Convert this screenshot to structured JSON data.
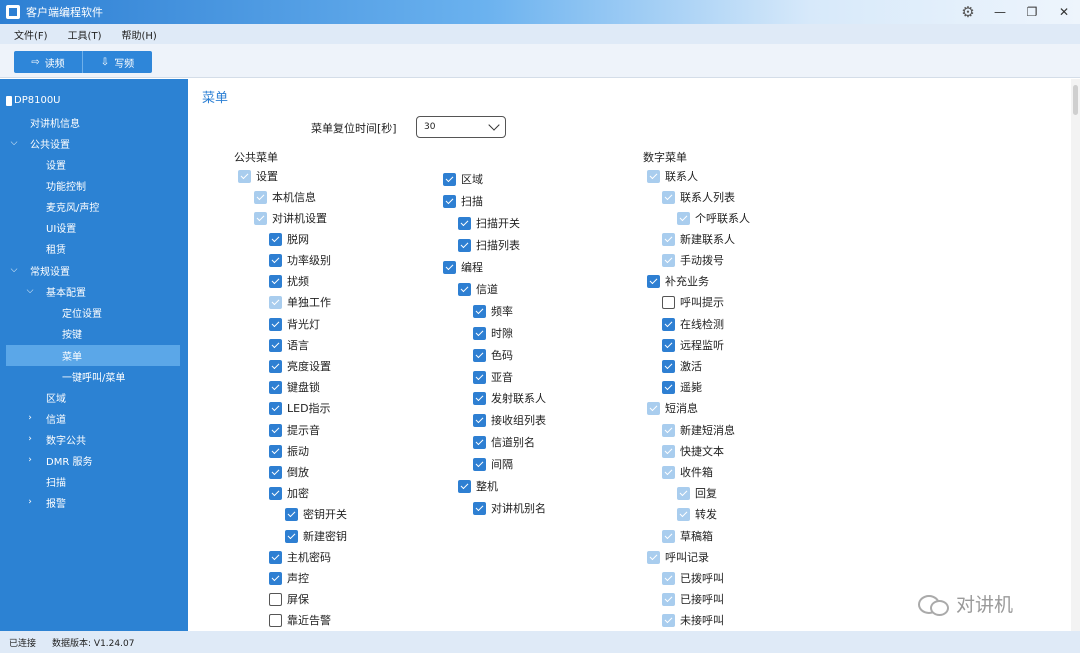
{
  "window": {
    "title": "客户端编程软件"
  },
  "menu": {
    "file": "文件(F)",
    "tools": "工具(T)",
    "help": "帮助(H)"
  },
  "toolbar": {
    "read": "读频",
    "write": "写频"
  },
  "sidebar": {
    "device": "DP8100U",
    "items": {
      "intercom_info": "对讲机信息",
      "public_settings": "公共设置",
      "settings": "设置",
      "function_control": "功能控制",
      "mic_audio": "麦克风/声控",
      "ui_settings": "UI设置",
      "rental": "租赁",
      "general_settings": "常规设置",
      "basic_config": "基本配置",
      "location": "定位设置",
      "keys": "按键",
      "menu": "菜单",
      "one_key_call": "一键呼叫/菜单",
      "zone": "区域",
      "channel": "信道",
      "digital_public": "数字公共",
      "dmr_service": "DMR 服务",
      "scan": "扫描",
      "alarm": "报警"
    }
  },
  "main": {
    "title": "菜单",
    "reset_label": "菜单复位时间[秒]",
    "reset_value": "30",
    "public_menu_label": "公共菜单",
    "digital_menu_label": "数字菜单",
    "col1": {
      "settings": "设置",
      "local_info": "本机信息",
      "radio_settings": "对讲机设置",
      "offline": "脱网",
      "power_level": "功率级别",
      "scramble": "扰频",
      "single_work": "单独工作",
      "backlight": "背光灯",
      "language": "语言",
      "brightness": "亮度设置",
      "keylock": "键盘锁",
      "led": "LED指示",
      "tone": "提示音",
      "vibrate": "振动",
      "fall": "倒放",
      "encrypt": "加密",
      "key_switch": "密钥开关",
      "new_key": "新建密钥",
      "host_password": "主机密码",
      "voice_control": "声控",
      "screensaver": "屏保",
      "proximity_alarm": "靠近告警"
    },
    "col2": {
      "zone": "区域",
      "scan": "扫描",
      "scan_switch": "扫描开关",
      "scan_list": "扫描列表",
      "program": "编程",
      "channel": "信道",
      "frequency": "频率",
      "timeslot": "时隙",
      "color_code": "色码",
      "subtone": "亚音",
      "tx_contact": "发射联系人",
      "rx_group": "接收组列表",
      "channel_alias": "信道别名",
      "interval": "间隔",
      "whole": "整机",
      "radio_alias": "对讲机别名"
    },
    "col3": {
      "contacts": "联系人",
      "contact_list": "联系人列表",
      "personal_contact": "个呼联系人",
      "new_contact": "新建联系人",
      "manual_dial": "手动拨号",
      "supplementary": "补充业务",
      "call_alert": "呼叫提示",
      "online_check": "在线检测",
      "remote_monitor": "远程监听",
      "activate": "激活",
      "stun": "遥毙",
      "sms": "短消息",
      "new_sms": "新建短消息",
      "quick_text": "快捷文本",
      "inbox": "收件箱",
      "reply": "回复",
      "forward": "转发",
      "drafts": "草稿箱",
      "call_log": "呼叫记录",
      "dialed": "已拨呼叫",
      "received": "已接呼叫",
      "missed": "未接呼叫"
    }
  },
  "watermark": "对讲机",
  "status": {
    "connected": "已连接",
    "version": "数据版本: V1.24.07"
  }
}
